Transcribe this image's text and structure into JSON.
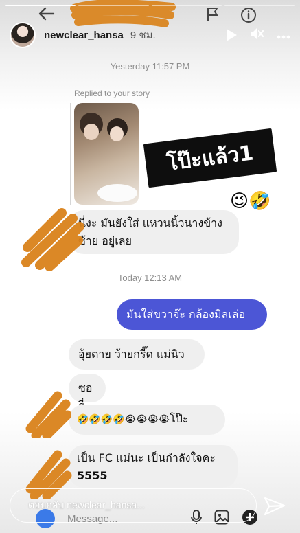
{
  "story": {
    "username": "newclear_hansa",
    "time_ago": "9 ชม.",
    "progress_segments": 4,
    "progress_done": 1
  },
  "chat": {
    "timestamp_1": "Yesterday 11:57 PM",
    "replied_label": "Replied to your story",
    "sticker_text": "โป๊ะแล้ว1",
    "sticker_emoji": "😉🤣",
    "msg_1": "นี่งะ มันยังใส่ แหวนนิ้วนางข้าง ซ้าย อยู่เลย",
    "timestamp_2": "Today 12:13 AM",
    "msg_me": "มันใส่ขวาจ๊ะ กล้องมิลเล่อ",
    "msg_2": "อุ้ยตาย ว้ายกรี๊ด  แม่นิว",
    "msg_3": "ซอรี่",
    "msg_4_emoji": "🤣🤣🤣🤣😭😭😭😭",
    "msg_4_text": "โป๊ะ",
    "msg_5_line1": "เป็น FC แม่นะ เป็นกำลังใจคะ",
    "msg_5_line2": "5555",
    "input_placeholder": "Message..."
  },
  "reply": {
    "placeholder": "ตอบกลับ newclear_hansa..."
  },
  "icons": {
    "play": "play-icon",
    "mute": "mute-icon",
    "more": "more-icon",
    "send": "send-icon"
  },
  "colors": {
    "my_bubble": "#4c56d6",
    "their_bubble": "#efefef",
    "scribble": "#d9821a"
  }
}
